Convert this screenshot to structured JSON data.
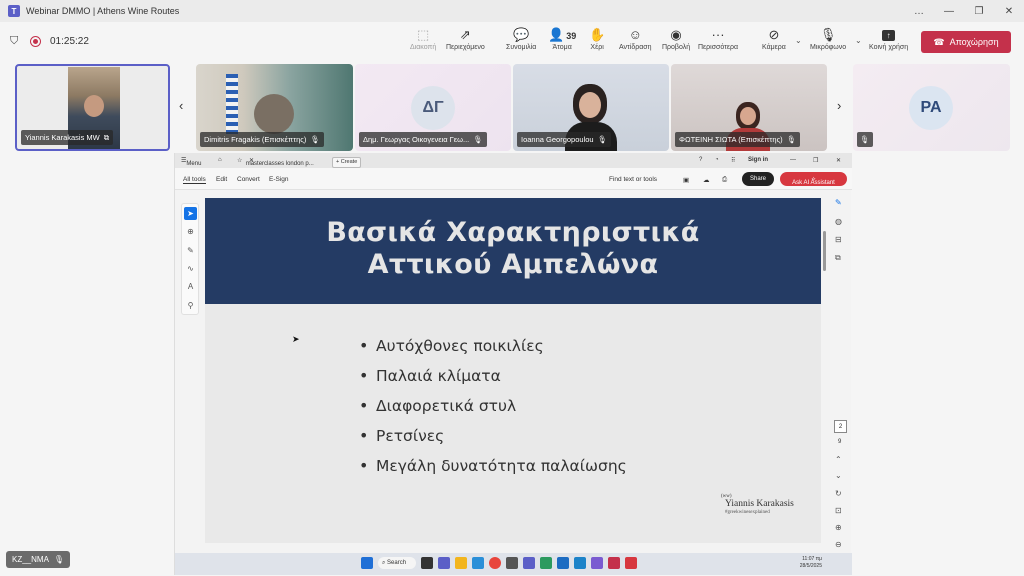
{
  "window": {
    "title": "Webinar DMMO | Athens Wine Routes",
    "controls": [
      "…",
      "—",
      "❐",
      "✕"
    ]
  },
  "meeting": {
    "timer": "01:25:22",
    "toolbar": {
      "diakopi": "Διακοπή",
      "content": "Περιεχόμενο",
      "chat": "Συνομιλία",
      "people": "Άτομα",
      "people_count": "39",
      "hand": "Χέρι",
      "reaction": "Αντίδραση",
      "view": "Προβολή",
      "more": "Περισσότερα",
      "camera": "Κάμερα",
      "mic": "Μικρόφωνο",
      "share": "Κοινή χρήση",
      "leave": "Αποχώρηση"
    },
    "participants": [
      {
        "name": "Yiannis Karakasis MW"
      },
      {
        "name": "Dimitris Fragakis (Επισκέπτης)"
      },
      {
        "name": "Δημ. Γεωργας Οικογενεια Γεω...",
        "initials": "ΔΓ"
      },
      {
        "name": "Ioanna Georgopoulou"
      },
      {
        "name": "ΦΩΤΕΙΝΗ ΣΙΩΤΑ (Επισκέπτης)"
      },
      {
        "name": "",
        "initials": "PA"
      }
    ],
    "self_tag": "KZ__NMA"
  },
  "shared_screen": {
    "browser": {
      "menu": "Menu",
      "tab": "masterclasses london p...",
      "new_tab": "+ Create",
      "sign_in": "Sign in"
    },
    "acrobat": {
      "all_tools": "All tools",
      "edit": "Edit",
      "convert": "Convert",
      "esign": "E-Sign",
      "find": "Find text or tools",
      "share": "Share",
      "ai": "Ask AI Assistant",
      "page_current": "2",
      "page_total": "9"
    },
    "slide": {
      "title_line1": "Βασικά Χαρακτηριστικά",
      "title_line2": "Αττικού Αμπελώνα",
      "bullets": [
        "Αυτόχθονες ποικιλίες",
        "Παλαιά κλίματα",
        "Διαφορετικά στυλ",
        "Ρετσίνες",
        "Μεγάλη δυνατότητα παλαίωσης"
      ],
      "signature_logo": "(ww)",
      "signature_name": "Yiannis Karakasis",
      "signature_handle": "#greekwinesexplained"
    },
    "taskbar": {
      "search": "Search",
      "time": "11:07 πμ",
      "date": "28/5/2025"
    }
  },
  "colors": {
    "leave": "#c4314b",
    "active_tile_border": "#5b5fc7",
    "slide_banner": "#243b64",
    "acrobat_ai": "#d7373f",
    "acrobat_select": "#1473e6"
  }
}
